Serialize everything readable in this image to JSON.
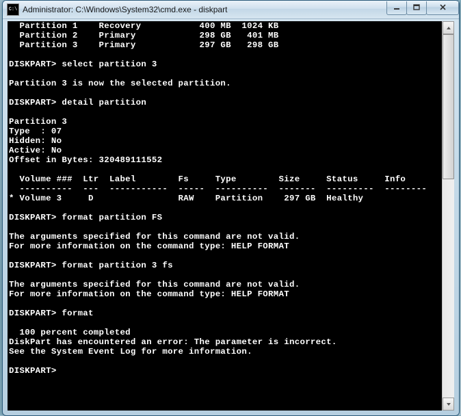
{
  "window": {
    "title": "Administrator: C:\\Windows\\System32\\cmd.exe - diskpart"
  },
  "terminal": {
    "lines": [
      "  Partition 1    Recovery           400 MB  1024 KB",
      "  Partition 2    Primary            298 GB   401 MB",
      "  Partition 3    Primary            297 GB   298 GB",
      "",
      "DISKPART> select partition 3",
      "",
      "Partition 3 is now the selected partition.",
      "",
      "DISKPART> detail partition",
      "",
      "Partition 3",
      "Type  : 07",
      "Hidden: No",
      "Active: No",
      "Offset in Bytes: 320489111552",
      "",
      "  Volume ###  Ltr  Label        Fs     Type        Size     Status     Info",
      "  ----------  ---  -----------  -----  ----------  -------  ---------  --------",
      "* Volume 3     D                RAW    Partition    297 GB  Healthy",
      "",
      "DISKPART> format partition FS",
      "",
      "The arguments specified for this command are not valid.",
      "For more information on the command type: HELP FORMAT",
      "",
      "DISKPART> format partition 3 fs",
      "",
      "The arguments specified for this command are not valid.",
      "For more information on the command type: HELP FORMAT",
      "",
      "DISKPART> format",
      "",
      "  100 percent completed",
      "DiskPart has encountered an error: The parameter is incorrect.",
      "See the System Event Log for more information.",
      "",
      "DISKPART>",
      ""
    ]
  }
}
